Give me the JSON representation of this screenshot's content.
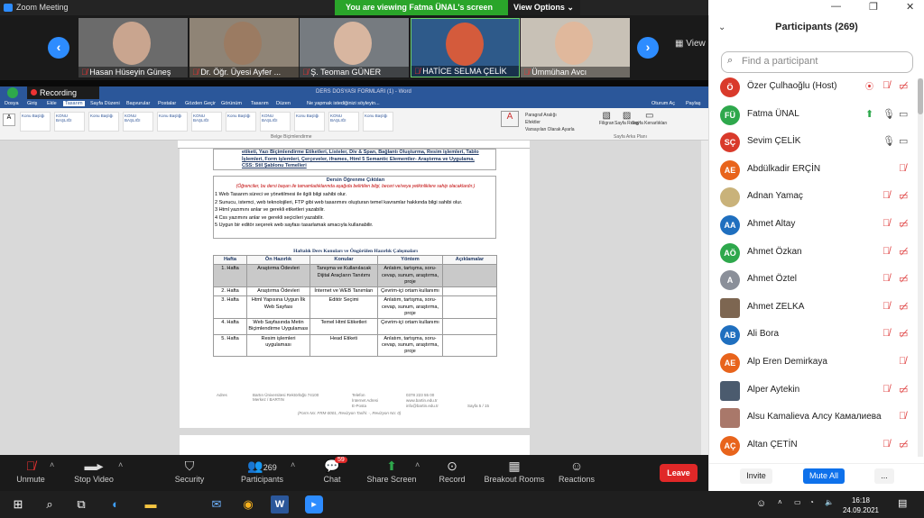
{
  "app": {
    "title": "Zoom Meeting",
    "banner": "You are viewing Fatma ÜNAL's screen",
    "view_options": "View Options ⌄",
    "view": "View"
  },
  "videos": [
    {
      "name": "Hasan Hüseyin Güneş"
    },
    {
      "name": "Dr. Öğr. Üyesi Ayfer ..."
    },
    {
      "name": "Ş. Teoman GÜNER"
    },
    {
      "name": "HATİCE SELMA ÇELİK"
    },
    {
      "name": "Ümmühan Avcı"
    }
  ],
  "word": {
    "recording": "Recording",
    "doc_title": "DERS DOSYASI FORMLARI (1) - Word",
    "tabs": [
      "Dosya",
      "Giriş",
      "Ekle",
      "Tasarım",
      "Sayfa Düzeni",
      "Başvurular",
      "Postalar",
      "Gözden Geçir",
      "Görünüm",
      "Tasarım",
      "Düzen"
    ],
    "search": "Ne yapmak istediğinizi söyleyin...",
    "signin": "Oturum Aç",
    "share": "Paylaş",
    "styles": [
      "Konu Başlığı",
      "KONU BAŞLIĞI",
      "Konu Başlığı",
      "KONU BAŞLIĞI",
      "Konu Başlığı",
      "KONU BAŞLIĞI",
      "Konu Başlığı",
      "KONU BAŞLIĞI",
      "Konu Başlığı",
      "KONU BAŞLIĞI",
      "Konu Başlığı"
    ],
    "para_options": [
      "Paragraf Aralığı",
      "Efektler",
      "Varsayılan Olarak Ayarla"
    ],
    "filigran": "Filigran",
    "page_color": "Sayfa Rengi",
    "page_border": "Sayfa Kenarlıkları",
    "ribbon_group_doc": "Belge Biçimlendirme",
    "ribbon_group_bg": "Sayfa Arka Planı"
  },
  "doc": {
    "prev_text": "etiketi, Yazı Biçimlendirme Etiketleri, Listeler, Div & Span, Bağlantı Oluşturma, Resim işlemleri, Tablo İşlemleri, Form işlemleri, Çerçeveler, iframes, Html 5 Semantic Elementler- Araştırma ve Uygulama, CSS: Stil Şablonu Temelleri",
    "outcomes_title": "Dersin Öğrenme Çıktıları",
    "outcomes_sub": "(Öğrenciler, bu dersi başarı ile tamamladıklarında aşağıda belirtilen bilgi, beceri ve/veya yetkinliklere sahip olacaklardır.)",
    "outcomes": [
      "1 Web Tasarım süreci ve yönetilmesi ile ilgili bilgi sahibi olur.",
      "2 Sunucu, istemci, web teknolojileri, FTP gibi web tasarımını oluşturan temel kavramlar hakkında bilgi sahibi olur.",
      "3 Html yazımını anlar ve gerekli etiketleri yazabilir.",
      "4 Css yazımını anlar ve gerekli seçicileri yazabilir.",
      "5 Uygun bir editör seçerek web sayfası tasarlamak amacıyla kullanabilir."
    ],
    "weekly_title": "Haftalık Ders Konuları ve Öngörülen Hazırlık Çalışmaları",
    "headers": [
      "Hafta",
      "Ön Hazırlık",
      "Konular",
      "Yöntem",
      "Açıklamalar"
    ],
    "rows": [
      [
        "1. Hafta",
        "Araştırma Ödevleri",
        "Tanışma ve Kullanılacak Dijital Araçların Tanıtımı",
        "Anlatım, tartışma, soru-cevap, sunum, araştırma, proje",
        ""
      ],
      [
        "2. Hafta",
        "Araştırma Ödevleri",
        "İnternet ve WEB Tanımları",
        "Çevrim-içi ortam kullanımı",
        ""
      ],
      [
        "3. Hafta",
        "Html Yapısına Uygun İlk Web Sayfası",
        "Editör Seçimi",
        "Anlatım, tartışma, soru-cevap, sunum, araştırma, proje",
        ""
      ],
      [
        "4. Hafta",
        "Web Sayfasında Metin Biçimlendirme Uygulaması",
        "Temel Html Etiketleri",
        "Çevrim-içi ortam kullanımı",
        ""
      ],
      [
        "5. Hafta",
        "Resim işlemleri uygulaması",
        "Head Etiketi",
        "Anlatım, tartışma, soru-cevap, sunum, araştırma, proje",
        ""
      ]
    ],
    "footer_labels": [
      "Adres",
      "Telefon",
      "İnternet Adresi",
      "E-Posta"
    ],
    "footer_values": [
      "Bartın Üniversitesi Rektörlüğü 74100 Merkez / BARTIN",
      "0378 223 55 00",
      "www.bartin.edu.tr",
      "info@bartin.edu.tr"
    ],
    "page_no": "Sayfa 5 / 15",
    "form_no": "(Form No: FRM-0001, Revizyon Tarihi: -, Revizyon No: 0)"
  },
  "toolbar": {
    "items": [
      "Unmute",
      "Stop Video",
      "Security",
      "Participants",
      "Chat",
      "Share Screen",
      "Record",
      "Breakout Rooms",
      "Reactions"
    ],
    "participant_count": "269",
    "chat_badge": "59",
    "leave": "Leave"
  },
  "panel": {
    "title": "Participants (269)",
    "find_placeholder": "Find a participant",
    "participants": [
      {
        "initials": "Ö",
        "name": "Özer Çulhaoğlu (Host)",
        "color": "#d93a2b"
      },
      {
        "initials": "FÜ",
        "name": "Fatma ÜNAL",
        "color": "#2ea84c"
      },
      {
        "initials": "SÇ",
        "name": "Sevim ÇELİK",
        "color": "#d93a2b"
      },
      {
        "initials": "AE",
        "name": "Abdülkadir ERÇİN",
        "color": "#e8641c"
      },
      {
        "initials": "",
        "name": "Adnan Yamaç",
        "color": "#c9b27a"
      },
      {
        "initials": "AA",
        "name": "Ahmet Altay",
        "color": "#1f6fbf"
      },
      {
        "initials": "AÖ",
        "name": "Ahmet Özkan",
        "color": "#2ea84c"
      },
      {
        "initials": "A",
        "name": "Ahmet Öztel",
        "color": "#8a8f99"
      },
      {
        "initials": "",
        "name": "Ahmet ZELKA",
        "color": "#7d6651"
      },
      {
        "initials": "AB",
        "name": "Ali Bora",
        "color": "#1f6fbf"
      },
      {
        "initials": "AE",
        "name": "Alp Eren Demirkaya",
        "color": "#e8641c"
      },
      {
        "initials": "",
        "name": "Alper Aytekin",
        "color": "#4b5b6e"
      },
      {
        "initials": "",
        "name": "Alsu Kamalieva Алсу Камалиева",
        "color": "#a9786a"
      },
      {
        "initials": "AÇ",
        "name": "Altan ÇETİN",
        "color": "#e8641c"
      }
    ],
    "invite": "Invite",
    "mute_all": "Mute All",
    "more": "..."
  },
  "taskbar": {
    "time": "16:18",
    "date": "24.09.2021"
  }
}
